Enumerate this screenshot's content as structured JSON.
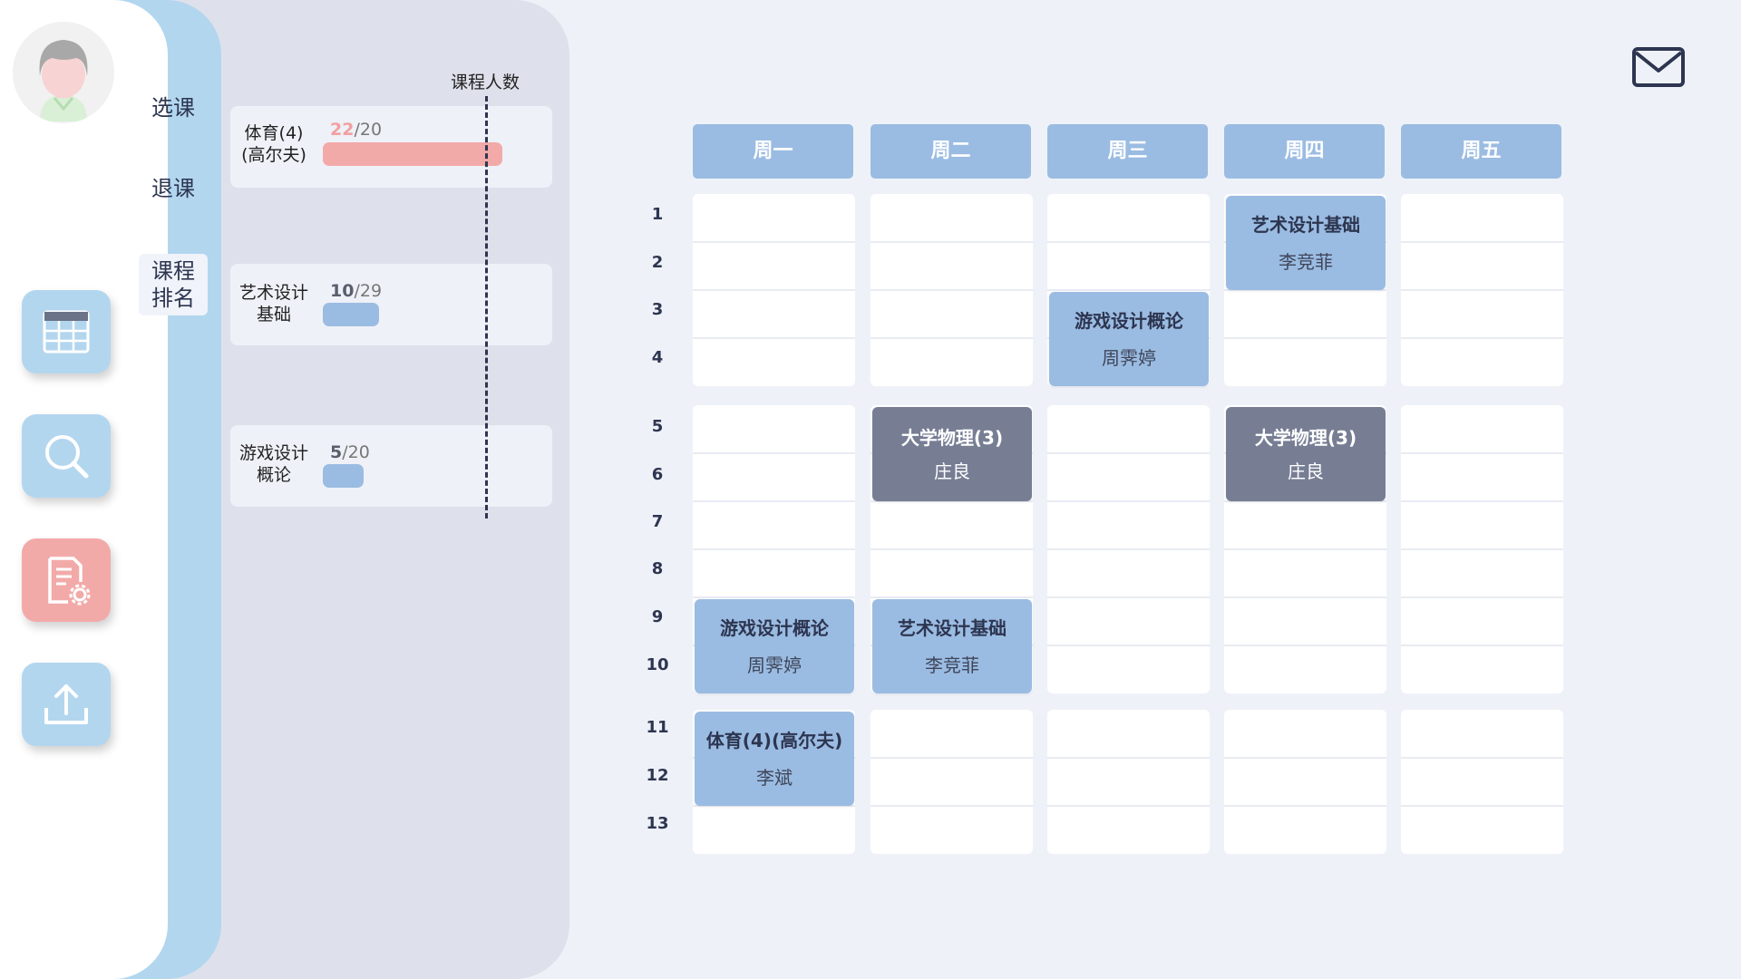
{
  "menu": {
    "items": [
      {
        "label": "选课"
      },
      {
        "label": "退课"
      },
      {
        "label": "课程\n排名"
      }
    ]
  },
  "ranking": {
    "title": "课程人数",
    "courses": [
      {
        "name": "体育(4)\n(高尔夫)",
        "enrolled": "22",
        "capacity": "/20",
        "fill": 1.1,
        "over": true,
        "color": "#f2aaa9"
      },
      {
        "name": "艺术设计\n基础",
        "enrolled": "10",
        "capacity": "/29",
        "fill": 0.345,
        "over": false,
        "color": "#9bbce2"
      },
      {
        "name": "游戏设计\n概论",
        "enrolled": "5",
        "capacity": "/20",
        "fill": 0.25,
        "over": false,
        "color": "#9bbce2"
      }
    ]
  },
  "schedule": {
    "days": [
      "周一",
      "周二",
      "周三",
      "周四",
      "周五"
    ],
    "periods": [
      "1",
      "2",
      "3",
      "4",
      "5",
      "6",
      "7",
      "8",
      "9",
      "10",
      "11",
      "12",
      "13"
    ],
    "courses": [
      {
        "name": "艺术设计基础",
        "teacher": "李竞菲",
        "day": 3,
        "start": 1,
        "end": 2,
        "style": "blue"
      },
      {
        "name": "游戏设计概论",
        "teacher": "周霁婷",
        "day": 2,
        "start": 3,
        "end": 4,
        "style": "blue"
      },
      {
        "name": "大学物理(3)",
        "teacher": "庄良",
        "day": 1,
        "start": 5,
        "end": 6,
        "style": "gray"
      },
      {
        "name": "大学物理(3)",
        "teacher": "庄良",
        "day": 3,
        "start": 5,
        "end": 6,
        "style": "gray"
      },
      {
        "name": "游戏设计概论",
        "teacher": "周霁婷",
        "day": 0,
        "start": 9,
        "end": 10,
        "style": "blue"
      },
      {
        "name": "艺术设计基础",
        "teacher": "李竞菲",
        "day": 1,
        "start": 9,
        "end": 10,
        "style": "blue"
      },
      {
        "name": "体育(4)(高尔夫)",
        "teacher": "李斌",
        "day": 0,
        "start": 11,
        "end": 12,
        "style": "blue"
      }
    ]
  },
  "icons": {
    "avatar": "user-avatar",
    "rail": [
      "calendar-icon",
      "search-icon",
      "document-settings-icon",
      "upload-icon"
    ],
    "mail": "mail-icon"
  },
  "colors": {
    "accent_blue": "#9bbce2",
    "menu_blue": "#b3d6ef",
    "alert_pink": "#f2aaa9",
    "course_gray": "#777e94"
  }
}
